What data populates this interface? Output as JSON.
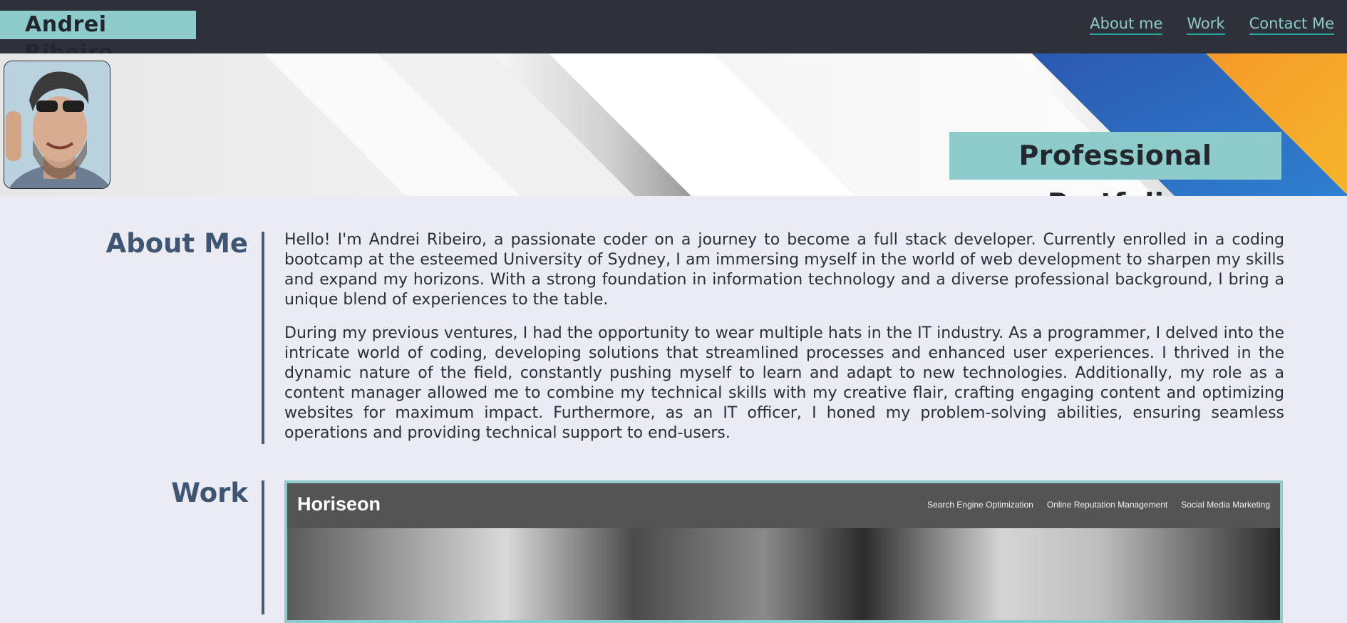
{
  "header": {
    "name": "Andrei Ribeiro",
    "nav": [
      {
        "label": "About me"
      },
      {
        "label": "Work"
      },
      {
        "label": "Contact Me"
      }
    ]
  },
  "hero": {
    "title": "Professional Portfolio"
  },
  "about": {
    "heading": "About Me",
    "paragraphs": [
      "Hello! I'm Andrei Ribeiro, a passionate coder on a journey to become a full stack developer. Currently enrolled in a coding bootcamp at the esteemed University of Sydney, I am immersing myself in the world of web development to sharpen my skills and expand my horizons. With a strong foundation in information technology and a diverse professional background, I bring a unique blend of experiences to the table.",
      "During my previous ventures, I had the opportunity to wear multiple hats in the IT industry. As a programmer, I delved into the intricate world of coding, developing solutions that streamlined processes and enhanced user experiences. I thrived in the dynamic nature of the field, constantly pushing myself to learn and adapt to new technologies. Additionally, my role as a content manager allowed me to combine my technical skills with my creative flair, crafting engaging content and optimizing websites for maximum impact. Furthermore, as an IT officer, I honed my problem-solving abilities, ensuring seamless operations and providing technical support to end-users."
    ]
  },
  "work": {
    "heading": "Work",
    "project": {
      "logo": "Horiseon",
      "links": [
        "Search Engine Optimization",
        "Online Reputation Management",
        "Social Media Marketing"
      ]
    }
  },
  "colors": {
    "header_bg": "#2e3139",
    "accent_teal": "#8ecbcb",
    "page_bg": "#eaebf3",
    "heading_blue": "#3f5673"
  }
}
